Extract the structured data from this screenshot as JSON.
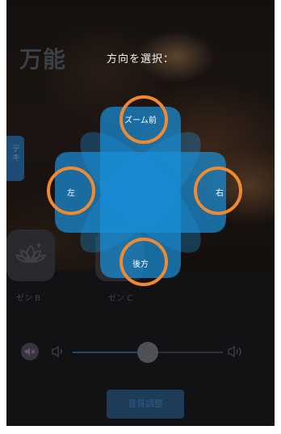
{
  "app": {
    "title": "万能",
    "side_tab_label": "テキ"
  },
  "overlay": {
    "prompt": "方向を選択："
  },
  "directions": {
    "up": "ズーム前",
    "left": "左",
    "right": "右",
    "down": "後方"
  },
  "presets": [
    {
      "label": "ゼン B"
    },
    {
      "label": "ゼン C"
    }
  ],
  "volume": {
    "level_percent": 50
  },
  "buttons": {
    "tone_adjust": "音質調整"
  },
  "colors": {
    "petal": "#1a8fd8",
    "highlight_ring": "#f08a30"
  }
}
